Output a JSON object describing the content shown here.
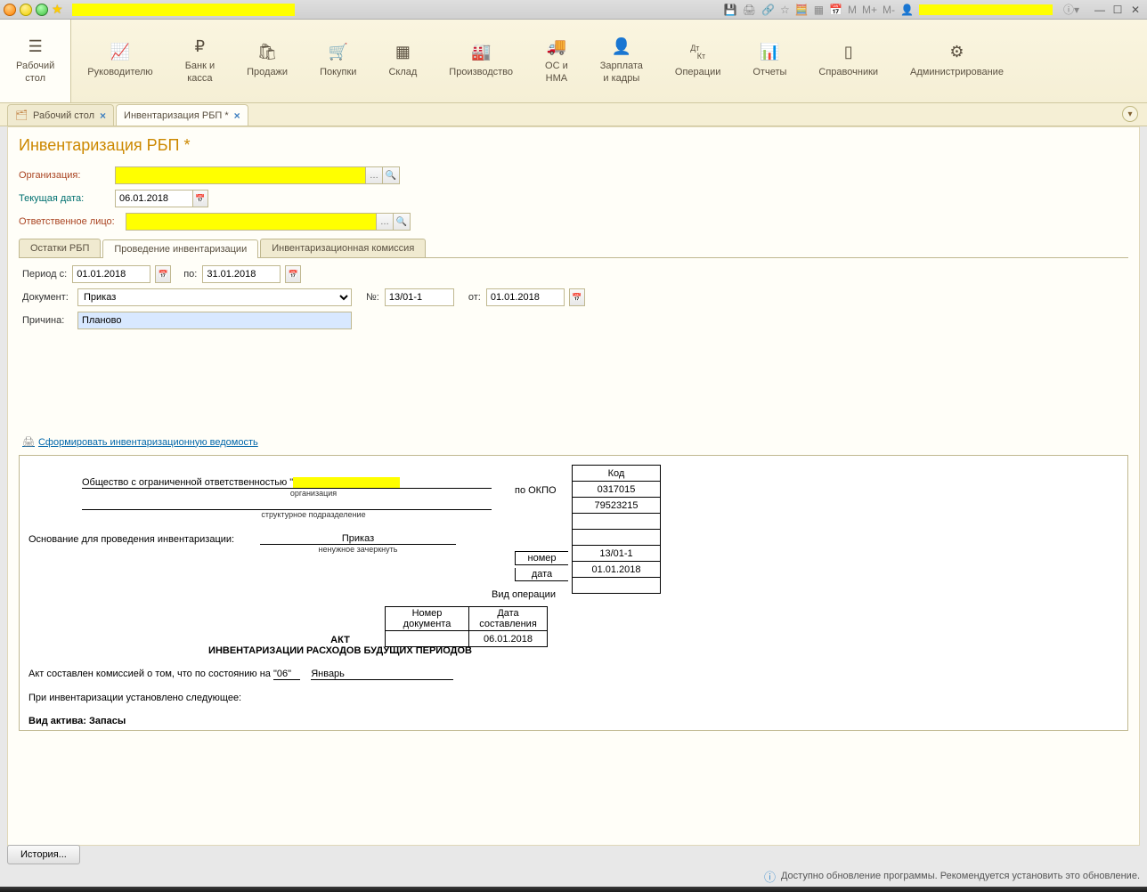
{
  "titlebar": {
    "right_markers": [
      "M",
      "M+",
      "M-"
    ]
  },
  "toolbar": {
    "items": [
      {
        "label": "Рабочий\nстол",
        "icon": "☰"
      },
      {
        "label": "Руководителю",
        "icon": "〰"
      },
      {
        "label": "Банк и\nкасса",
        "icon": "₽"
      },
      {
        "label": "Продажи",
        "icon": "▮"
      },
      {
        "label": "Покупки",
        "icon": "🛒"
      },
      {
        "label": "Склад",
        "icon": "▦"
      },
      {
        "label": "Производство",
        "icon": "🏭"
      },
      {
        "label": "ОС и\nНМА",
        "icon": "🚚"
      },
      {
        "label": "Зарплата\nи кадры",
        "icon": "👤"
      },
      {
        "label": "Операции",
        "icon": "Дт Кт"
      },
      {
        "label": "Отчеты",
        "icon": "▮▮"
      },
      {
        "label": "Справочники",
        "icon": "▯"
      },
      {
        "label": "Администрирование",
        "icon": "⚙"
      }
    ]
  },
  "tabs": [
    {
      "label": "Рабочий стол"
    },
    {
      "label": "Инвентаризация РБП *"
    }
  ],
  "page": {
    "title": "Инвентаризация РБП *",
    "org_label": "Организация:",
    "org_value": "",
    "curdate_label": "Текущая дата:",
    "curdate_value": "06.01.2018",
    "resp_label": "Ответственное лицо:",
    "resp_value": ""
  },
  "subtabs": {
    "t1": "Остатки РБП",
    "t2": "Проведение инвентаризации",
    "t3": "Инвентаризационная комиссия"
  },
  "inv": {
    "period_label": "Период с:",
    "period_from": "01.01.2018",
    "period_to_label": "по:",
    "period_to": "31.01.2018",
    "doc_label": "Документ:",
    "doc_value": "Приказ",
    "num_label": "№:",
    "num_value": "13/01-1",
    "from_label": "от:",
    "from_value": "01.01.2018",
    "reason_label": "Причина:",
    "reason_value": "Планово"
  },
  "link": {
    "form_report": "Сформировать инвентаризационную ведомость"
  },
  "report": {
    "org_prefix": "Общество с ограниченной ответственностью \"",
    "org_caption": "организация",
    "subdiv_caption": "структурное подразделение",
    "okpo_label": "по ОКПО",
    "code_header": "Код",
    "code_value": "0317015",
    "okpo_value": "79523215",
    "basis_label": "Основание для проведения инвентаризации:",
    "basis_value": "Приказ",
    "basis_caption": "ненужное зачеркнуть",
    "num_label": "номер",
    "num_value": "13/01-1",
    "date_label": "дата",
    "date_value": "01.01.2018",
    "optype_label": "Вид операции",
    "docnum_hdr": "Номер документа",
    "docdate_hdr": "Дата составления",
    "docdate_val": "06.01.2018",
    "act_title_1": "АКТ",
    "act_title_2": "ИНВЕНТАРИЗАЦИИ РАСХОДОВ БУДУЩИХ ПЕРИОДОВ",
    "act_line1_a": "Акт составлен комиссией о том, что по состоянию на ",
    "act_line1_day": "\"06\"",
    "act_line1_month": "Январь",
    "act_line2": "При инвентаризации установлено следующее:",
    "asset_type": "Вид актива: Запасы"
  },
  "bottom": {
    "history_btn": "История...",
    "status_msg": "Доступно обновление программы. Рекомендуется установить это обновление."
  }
}
